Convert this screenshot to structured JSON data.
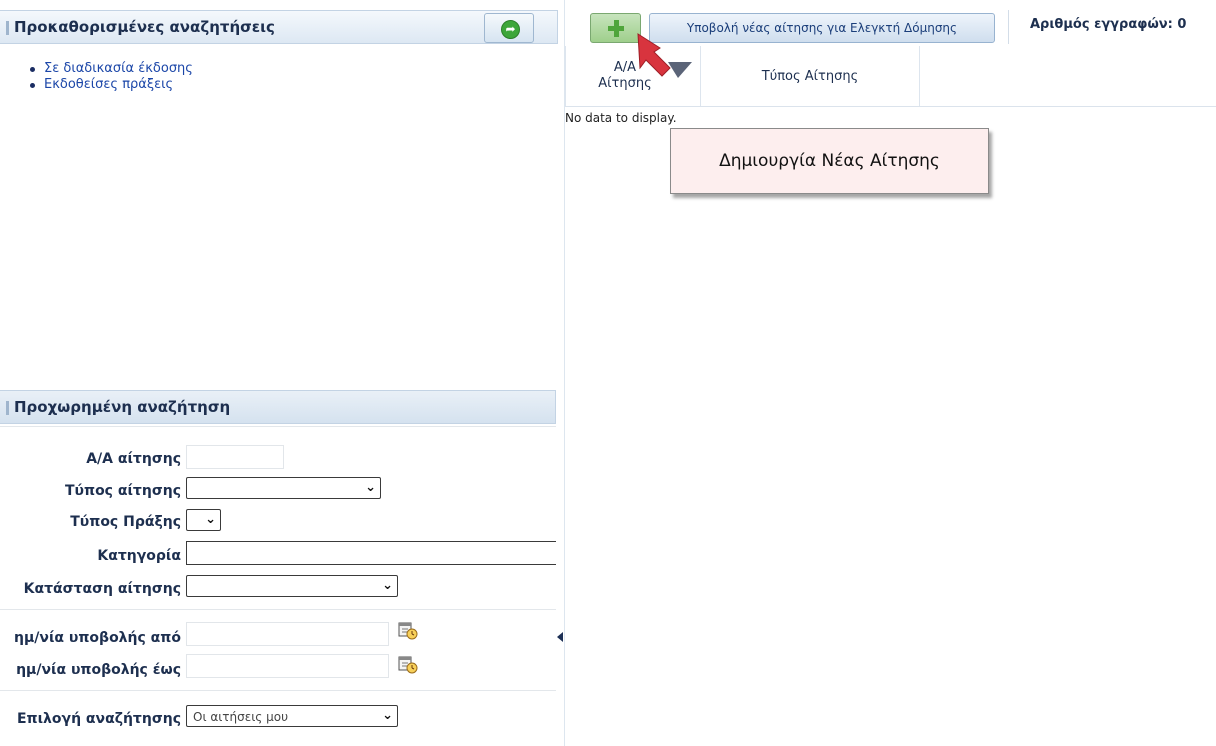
{
  "left_panel": {
    "predefined_title": "Προκαθορισμένες αναζητήσεις",
    "links": [
      "Σε διαδικασία έκδοσης",
      "Εκδοθείσες πράξεις"
    ],
    "advanced_title": "Προχωρημένη αναζήτηση"
  },
  "form": {
    "aa_label": "Α/Α αίτησης",
    "type_label": "Τύπος αίτησης",
    "act_type_label": "Τύπος Πράξης",
    "category_label": "Κατηγορία",
    "status_label": "Κατάσταση αίτησης",
    "date_from_label": "ημ/νία υποβολής από",
    "date_to_label": "ημ/νία υποβολής έως",
    "search_choice_label": "Επιλογή αναζήτησης",
    "search_choice_value": "Οι αιτήσεις μου"
  },
  "toolbar": {
    "submit_label": "Υποβολή νέας αίτησης για Ελεγκτή Δόμησης",
    "count_label": "Αριθμός εγγραφών: 0"
  },
  "grid": {
    "col_aa": "Α/Α Αίτησης",
    "col_type": "Τύπος Αίτησης",
    "empty": "No data to display."
  },
  "callout": {
    "text": "Δημιουργία Νέας Αίτησης"
  },
  "colors": {
    "callout_arrow": "#d8343e",
    "plus_green": "#4fa53b"
  },
  "icons": [
    "green-arrow-icon",
    "plus-icon",
    "calendar-icon",
    "chevron-down-icon",
    "collapse-left-icon"
  ]
}
